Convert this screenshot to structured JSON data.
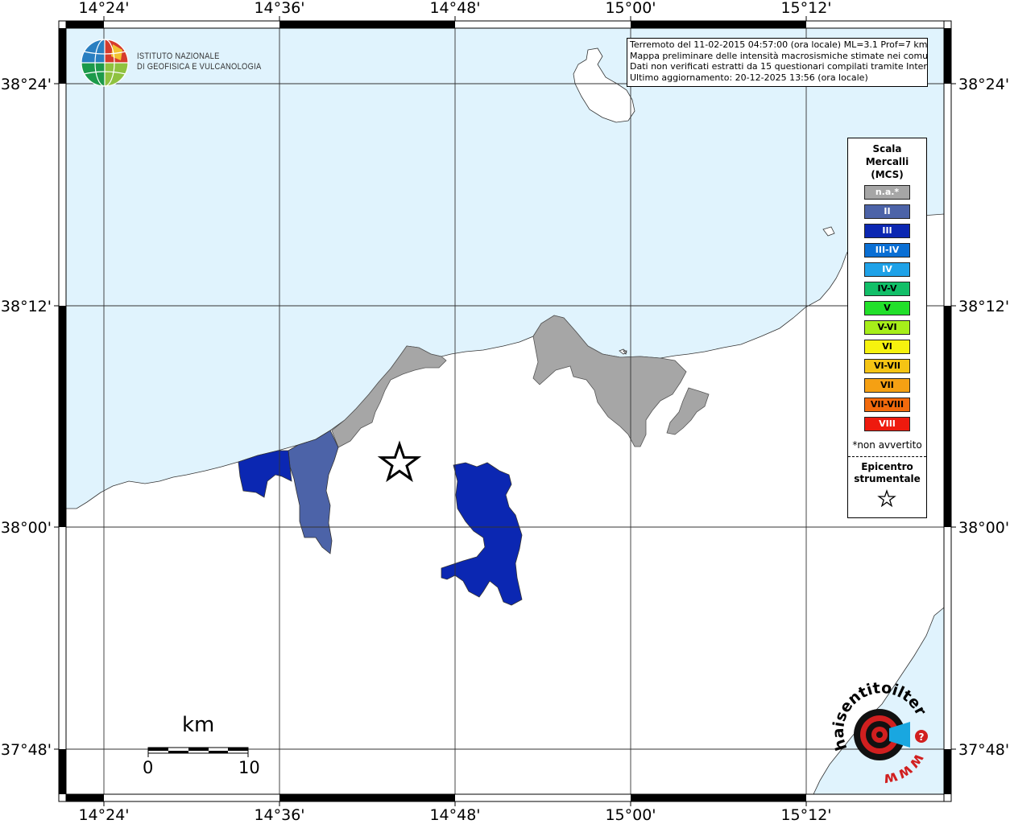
{
  "map": {
    "lon_labels": [
      "14°24'",
      "14°36'",
      "14°48'",
      "15°00'",
      "15°12'"
    ],
    "lat_labels": [
      "38°24'",
      "38°12'",
      "38°00'",
      "37°48'"
    ]
  },
  "info_box": {
    "lines": [
      "Terremoto del 11-02-2015 04:57:00 (ora locale) ML=3.1 Prof=7 km",
      "Mappa preliminare delle intensità macrosismiche stimate nei comuni",
      "Dati non verificati estratti da 15 questionari compilati tramite Internet.",
      "Ultimo aggiornamento: 20-12-2025 13:56 (ora locale)"
    ]
  },
  "logo": {
    "line1": "ISTITUTO NAZIONALE",
    "line2": "DI GEOFISICA E VULCANOLOGIA"
  },
  "legend": {
    "title_lines": [
      "Scala",
      "Mercalli",
      "(MCS)"
    ],
    "items": [
      {
        "label": "n.a.*",
        "color": "#a6a6a6",
        "text_color": "#ffffff"
      },
      {
        "label": "II",
        "color": "#4c63a8",
        "text_color": "#ffffff"
      },
      {
        "label": "III",
        "color": "#0b27b2",
        "text_color": "#ffffff"
      },
      {
        "label": "III-IV",
        "color": "#0a6fd4",
        "text_color": "#ffffff"
      },
      {
        "label": "IV",
        "color": "#1fa2e8",
        "text_color": "#ffffff"
      },
      {
        "label": "IV-V",
        "color": "#12bf68",
        "text_color": "#000000"
      },
      {
        "label": "V",
        "color": "#22e02a",
        "text_color": "#000000"
      },
      {
        "label": "V-VI",
        "color": "#a6ee1a",
        "text_color": "#000000"
      },
      {
        "label": "VI",
        "color": "#f6f20e",
        "text_color": "#000000"
      },
      {
        "label": "VI-VII",
        "color": "#f5c414",
        "text_color": "#000000"
      },
      {
        "label": "VII",
        "color": "#f5a013",
        "text_color": "#000000"
      },
      {
        "label": "VII-VIII",
        "color": "#f26a0c",
        "text_color": "#000000"
      },
      {
        "label": "VIII",
        "color": "#ee1a0e",
        "text_color": "#ffffff"
      }
    ],
    "note": "*non avvertito",
    "epicenter_lines": [
      "Epicentro",
      "strumentale"
    ]
  },
  "scale_bar": {
    "title": "km",
    "start": "0",
    "end": "10"
  },
  "haisentito": {
    "text_top": "haisentitoilterremoto.it",
    "text_bottom": "www."
  },
  "colors": {
    "sea": "#e0f3fd",
    "land": "#ffffff",
    "na": "#a6a6a6",
    "II": "#4c63a8",
    "III": "#0b27b2"
  }
}
